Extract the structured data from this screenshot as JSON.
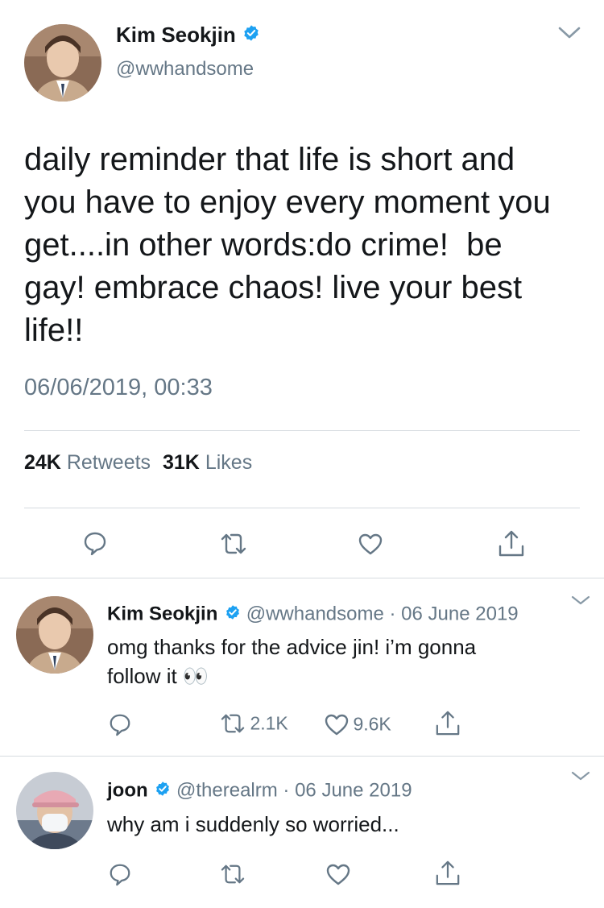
{
  "main_tweet": {
    "author_name": "Kim Seokjin",
    "handle": "@wwhandsome",
    "text_lines": [
      "daily reminder that life is short and",
      "you have to enjoy every moment you",
      "get....in other words:do crime!  be",
      "gay! embrace chaos! live your best",
      "life!!"
    ],
    "timestamp": "06/06/2019, 00:33",
    "retweet_count": "24K",
    "retweet_label": "Retweets",
    "like_count": "31K",
    "like_label": "Likes",
    "icons": [
      "reply-icon",
      "retweet-icon",
      "like-icon",
      "share-icon"
    ]
  },
  "replies": [
    {
      "author_name": "Kim Seokjin",
      "handle": "@wwhandsome",
      "date": "06 June 2019",
      "separator": "·",
      "text_lines": [
        "omg thanks for the advice jin! i’m gonna",
        "follow it 👀"
      ],
      "retweet_count": "2.1K",
      "like_count": "9.6K"
    },
    {
      "author_name": "joon",
      "handle": "@therealrm",
      "date": "06 June 2019",
      "separator": "·",
      "text_lines": [
        "why am i suddenly so worried..."
      ],
      "retweet_count": "",
      "like_count": ""
    }
  ],
  "colors": {
    "verified": "#1da1f2",
    "muted": "#657786",
    "icon": "#657786",
    "text": "#14171a"
  }
}
